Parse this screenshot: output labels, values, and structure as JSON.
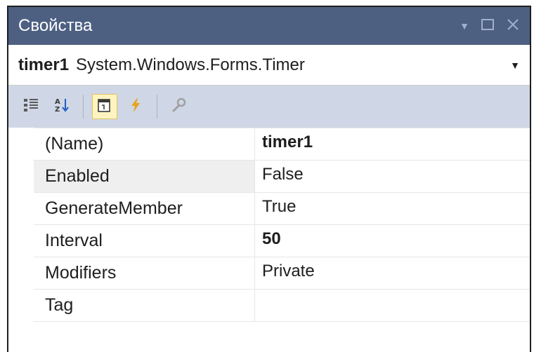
{
  "window": {
    "title": "Свойства"
  },
  "object": {
    "name": "timer1",
    "type": "System.Windows.Forms.Timer"
  },
  "toolbar": {
    "buttons": [
      {
        "icon": "categorized-icon",
        "active": false
      },
      {
        "icon": "alphabetical-icon",
        "active": false
      },
      {
        "icon": "properties-icon",
        "active": true
      },
      {
        "icon": "events-icon",
        "active": false
      },
      {
        "icon": "property-pages-icon",
        "active": false
      }
    ]
  },
  "properties": [
    {
      "name": "(Name)",
      "value": "timer1",
      "bold": true
    },
    {
      "name": "Enabled",
      "value": "False",
      "bold": false
    },
    {
      "name": "GenerateMember",
      "value": "True",
      "bold": false
    },
    {
      "name": "Interval",
      "value": "50",
      "bold": true
    },
    {
      "name": "Modifiers",
      "value": "Private",
      "bold": false
    },
    {
      "name": "Tag",
      "value": "",
      "bold": false
    }
  ],
  "colors": {
    "titlebar": "#4d6082",
    "toolbar": "#cfd6e5",
    "active_button": "#fdf4bf"
  }
}
